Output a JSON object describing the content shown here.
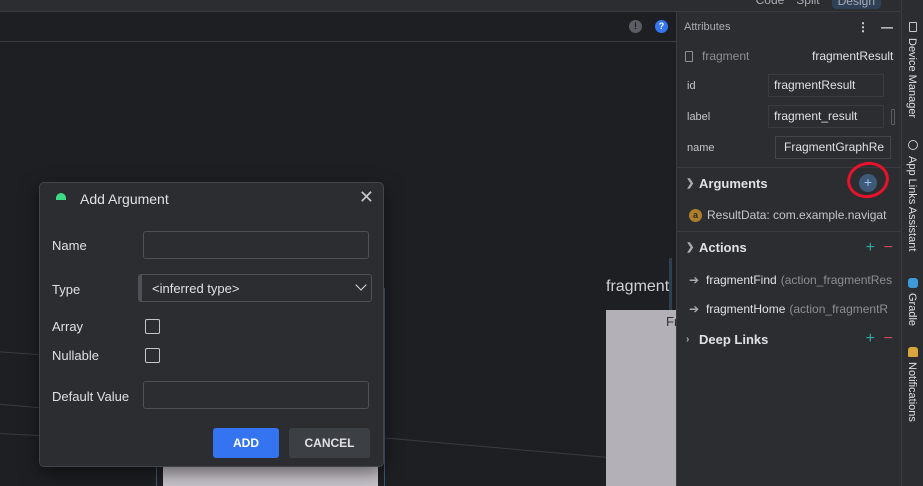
{
  "view_modes": {
    "code": "Code",
    "split": "Split",
    "design": "Design"
  },
  "canvas": {
    "warning_icon": "warning-icon",
    "help_icon": "help-icon",
    "fragment_label": "fragment",
    "fragment_preview_text": "Fr"
  },
  "attributes": {
    "header": "Attributes",
    "more_icon": "more-vertical-icon",
    "minimize_icon": "minimize-icon",
    "fragment_type": "fragment",
    "fragment_name": "fragmentResult",
    "props": [
      {
        "label": "id",
        "value": "fragmentResult"
      },
      {
        "label": "label",
        "value": "fragment_result"
      },
      {
        "label": "name",
        "value": "FragmentGraphRe"
      }
    ],
    "arguments": {
      "title": "Arguments",
      "add_icon": "+",
      "items": [
        {
          "text": "ResultData: com.example.navigat"
        }
      ]
    },
    "actions": {
      "title": "Actions",
      "items": [
        {
          "name": "fragmentFind",
          "detail": "(action_fragmentRes"
        },
        {
          "name": "fragmentHome",
          "detail": "(action_fragmentR"
        }
      ]
    },
    "deep_links": {
      "title": "Deep Links"
    },
    "plus": "+",
    "minus": "−"
  },
  "tool_windows": [
    {
      "label": "Device Manager"
    },
    {
      "label": "App Links Assistant"
    },
    {
      "label": "Gradle"
    },
    {
      "label": "Notifications"
    }
  ],
  "dialog": {
    "title": "Add Argument",
    "close": "✕",
    "name_label": "Name",
    "name_value": "",
    "type_label": "Type",
    "type_value": "<inferred type>",
    "array_label": "Array",
    "array_checked": false,
    "nullable_label": "Nullable",
    "nullable_checked": false,
    "default_label": "Default Value",
    "default_value": "",
    "add_button": "ADD",
    "cancel_button": "CANCEL"
  },
  "colors": {
    "accent": "#3574f0",
    "highlight": "#e8132b",
    "android": "#3ddc84"
  }
}
